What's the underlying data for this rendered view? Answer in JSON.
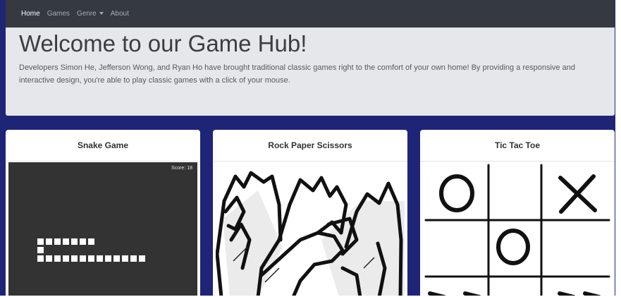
{
  "navbar": {
    "items": [
      {
        "label": "Home",
        "active": true
      },
      {
        "label": "Games"
      },
      {
        "label": "Genre",
        "dropdown": true
      },
      {
        "label": "About"
      }
    ]
  },
  "jumbotron": {
    "title": "Welcome to our Game Hub!",
    "text": "Developers Simon He, Jefferson Wong, and Ryan Ho have brought traditional classic games right to the comfort of your own home! By providing a responsive and interactive design, you're able to play classic games with a click of your mouse."
  },
  "cards": [
    {
      "title": "Snake Game",
      "score_text": "Score: 18"
    },
    {
      "title": "Rock Paper Scissors"
    },
    {
      "title": "Tic Tac Toe"
    }
  ],
  "colors": {
    "page_background": "#1e2577",
    "navbar": "#343a40",
    "jumbotron": "#e6e7ea",
    "snake_board": "#333333"
  }
}
